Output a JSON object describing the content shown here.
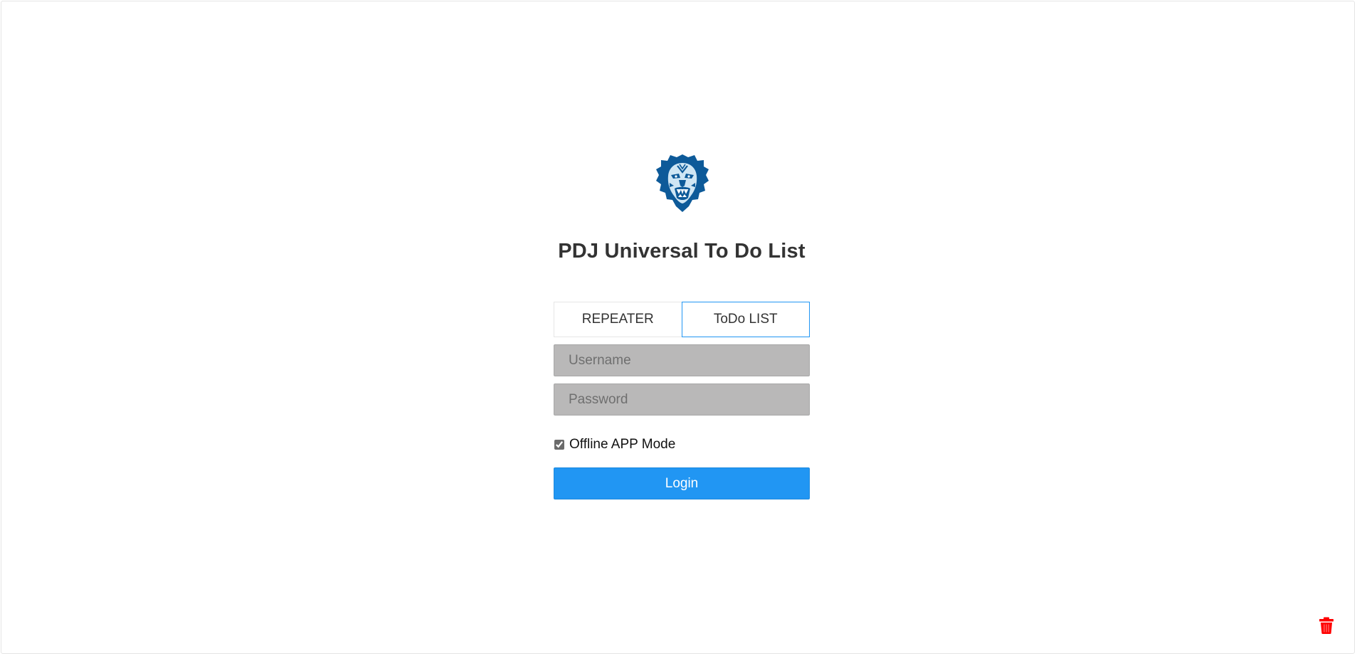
{
  "app": {
    "title": "PDJ Universal To Do List",
    "logo_icon": "lion-head-logo-icon",
    "accent_color": "#2196f3"
  },
  "tabs": [
    {
      "label": "REPEATER",
      "active": false
    },
    {
      "label": "ToDo LIST",
      "active": true
    }
  ],
  "login_form": {
    "username_placeholder": "Username",
    "username_value": "",
    "password_placeholder": "Password",
    "password_value": "",
    "offline_mode_label": "Offline APP Mode",
    "offline_mode_checked": true,
    "login_label": "Login"
  },
  "footer": {
    "trash_icon": "trash-icon",
    "trash_color": "#ff0000"
  }
}
